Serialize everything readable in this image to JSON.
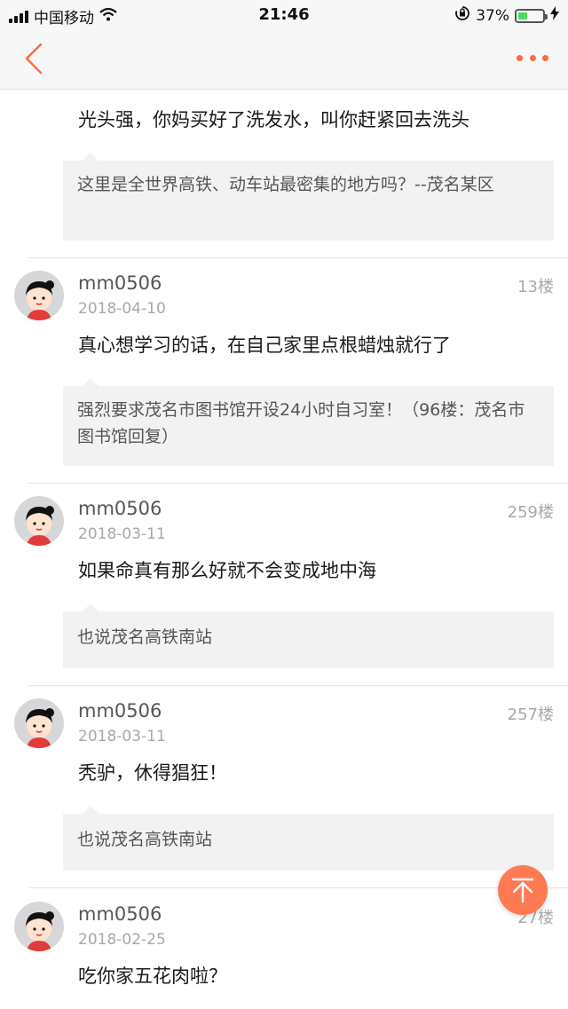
{
  "status_bar": {
    "carrier": "中国移动",
    "time": "21:46",
    "battery_percent": "37%",
    "battery_level": 0.37,
    "icons": [
      "signal-icon",
      "wifi-icon",
      "orientation-lock-icon",
      "battery-icon",
      "charging-icon"
    ]
  },
  "nav": {
    "back_icon": "chevron-left-icon",
    "more_icon": "more-dots-icon",
    "accent_color": "#ff6a3c"
  },
  "posts": [
    {
      "text": "光头强，你妈买好了洗发水，叫你赶紧回去洗头",
      "quote": "这里是全世界高铁、动车站最密集的地方吗？--茂名某区"
    },
    {
      "username": "mm0506",
      "date": "2018-04-10",
      "floor": "13楼",
      "text": "真心想学习的话，在自己家里点根蜡烛就行了",
      "quote": "强烈要求茂名市图书馆开设24小时自习室！（96楼：茂名市图书馆回复）"
    },
    {
      "username": "mm0506",
      "date": "2018-03-11",
      "floor": "259楼",
      "text": "如果命真有那么好就不会变成地中海",
      "quote": "也说茂名高铁南站"
    },
    {
      "username": "mm0506",
      "date": "2018-03-11",
      "floor": "257楼",
      "text": "秃驴，休得猖狂！",
      "quote": "也说茂名高铁南站"
    },
    {
      "username": "mm0506",
      "date": "2018-02-25",
      "floor": "27楼",
      "text": "吃你家五花肉啦？"
    }
  ],
  "scroll_top": {
    "icon": "arrow-up-to-top-icon",
    "color": "#ff7a52"
  }
}
